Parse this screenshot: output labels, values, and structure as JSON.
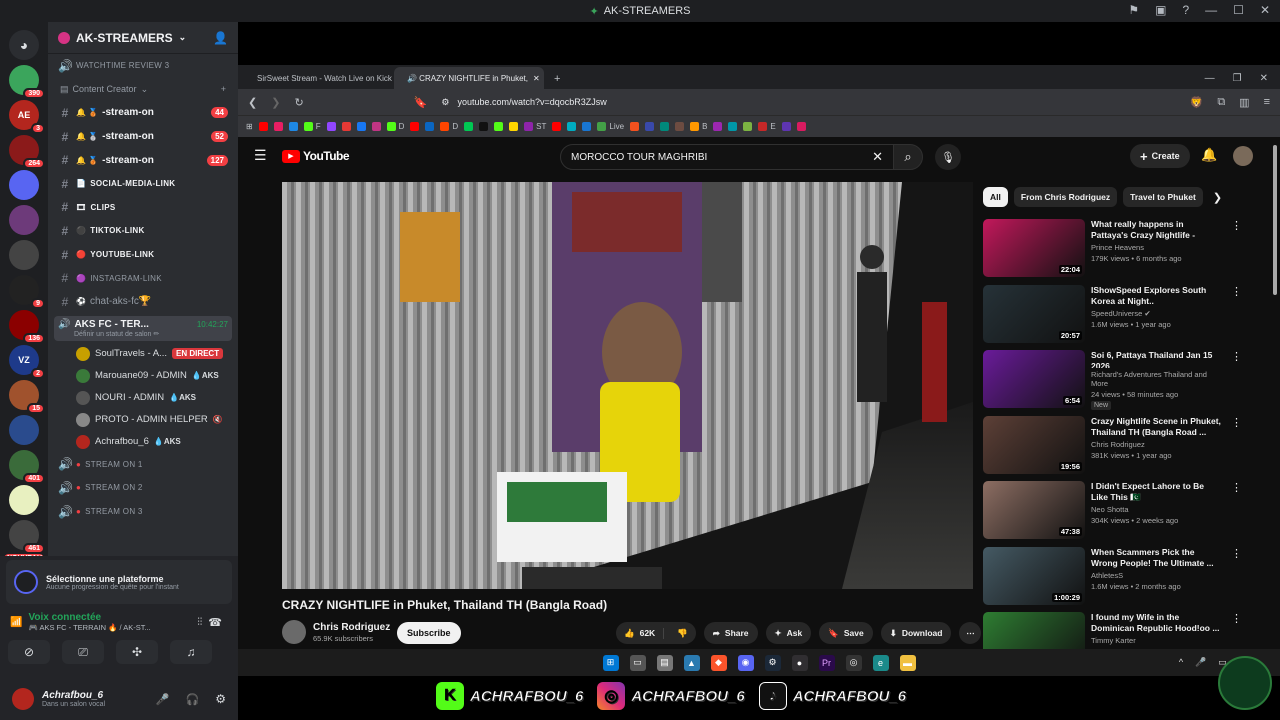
{
  "app": {
    "title": "AK-STREAMERS"
  },
  "rail": {
    "servers": [
      {
        "color": "#2b2d31",
        "label": "",
        "badge": ""
      },
      {
        "color": "#3ba55c",
        "label": "",
        "badge": "390"
      },
      {
        "color": "#b3261e",
        "label": "AE",
        "badge": "3"
      },
      {
        "color": "#8b1a1a",
        "label": "",
        "badge": "264"
      },
      {
        "color": "#5865f2",
        "label": "",
        "badge": ""
      },
      {
        "color": "#6d3a7a",
        "label": "",
        "badge": ""
      },
      {
        "color": "#444",
        "label": "",
        "badge": ""
      },
      {
        "color": "#222",
        "label": "",
        "badge": "9"
      },
      {
        "color": "#8b0000",
        "label": "",
        "badge": "136"
      },
      {
        "color": "#1e3a8a",
        "label": "VZ",
        "badge": "2"
      },
      {
        "color": "#a0522d",
        "label": "",
        "badge": "15"
      },
      {
        "color": "#2a4b8d",
        "label": "",
        "badge": ""
      },
      {
        "color": "#3a6b3a",
        "label": "",
        "badge": "401"
      },
      {
        "color": "#e8f0c0",
        "label": "",
        "badge": ""
      },
      {
        "color": "#444",
        "label": "",
        "badge": "461"
      }
    ],
    "nouveau": "NOUVEAU"
  },
  "sidebar": {
    "server_name": "AK-STREAMERS",
    "channels": [
      {
        "icon": "🔊",
        "prefix": "",
        "label": "WATCHTIME REVIEW 3",
        "count": "",
        "style": "small"
      },
      {
        "icon": "",
        "prefix": "",
        "label": "Content Creator",
        "count": "",
        "style": "category"
      },
      {
        "icon": "#",
        "prefix": "🔔 🥉",
        "label": "-stream-on",
        "count": "44",
        "style": "strong"
      },
      {
        "icon": "#",
        "prefix": "🔔 🥈",
        "label": "-stream-on",
        "count": "52",
        "style": "strong"
      },
      {
        "icon": "#",
        "prefix": "🔔 🥉",
        "label": "-stream-on",
        "count": "127",
        "style": "strong"
      },
      {
        "icon": "#",
        "prefix": "📄",
        "label": "SOCIAL-MEDIA-LINK",
        "count": "",
        "style": "strong small"
      },
      {
        "icon": "#",
        "prefix": "🎞",
        "label": "CLIPS",
        "count": "",
        "style": "strong small"
      },
      {
        "icon": "#",
        "prefix": "⚫",
        "label": "TIKTOK-LINK",
        "count": "",
        "style": "strong small"
      },
      {
        "icon": "#",
        "prefix": "🔴",
        "label": "YOUTUBE-LINK",
        "count": "",
        "style": "strong small"
      },
      {
        "icon": "#",
        "prefix": "🟣",
        "label": "INSTAGRAM-LINK",
        "count": "",
        "style": "small"
      },
      {
        "icon": "#",
        "prefix": "⚽",
        "label": "chat-aks-fc🏆",
        "count": "",
        "style": ""
      }
    ],
    "active_voice": {
      "label": "AKS FC - TER...",
      "time": "10:42:27",
      "status": "Définir un statut de salon ✏"
    },
    "voice_users": [
      {
        "name": "SoulTravels - A...",
        "tag": "EN DIRECT",
        "color": "#c7a000"
      },
      {
        "name": "Marouane09 - ADMIN",
        "tag": "💧AKS",
        "color": "#3a7a3a"
      },
      {
        "name": "NOURI - ADMIN",
        "tag": "💧AKS",
        "color": "#555"
      },
      {
        "name": "PROTO - ADMIN HELPER",
        "tag": "🔇",
        "color": "#888"
      },
      {
        "name": "Achrafbou_6",
        "tag": "💧AKS",
        "color": "#b3261e"
      }
    ],
    "streams": [
      "STREAM ON 1",
      "STREAM ON 2",
      "STREAM ON 3"
    ]
  },
  "panel": {
    "platform_title": "Sélectionne une plateforme",
    "platform_sub": "Aucune progression de quête pour l'instant",
    "voice_title": "Voix connectée",
    "voice_sub": "🎮 AKS FC - TERRAIN 🔥 / AK-ST...",
    "username": "Achrafbou_6",
    "user_status": "Dans un salon vocal"
  },
  "browser": {
    "tabs": [
      {
        "label": "SirSweet Stream - Watch Live on Kick",
        "active": false
      },
      {
        "label": "🔊 CRAZY NIGHTLIFE in Phuket,",
        "active": true
      }
    ],
    "url": "youtube.com/watch?v=dqocbR3ZJsw",
    "bookmarks": [
      "F",
      "D",
      "D",
      "ST",
      "Live",
      "B",
      "E"
    ]
  },
  "youtube": {
    "logo": "YouTube",
    "search_query": "MOROCCO TOUR MAGHRIBI",
    "create_label": "Create",
    "video_title": "CRAZY NIGHTLIFE in Phuket, Thailand TH (Bangla Road)",
    "channel": "Chris Rodriguez",
    "subscribers": "65.9K subscribers",
    "subscribe_label": "Subscribe",
    "likes": "62K",
    "share_label": "Share",
    "ask_label": "Ask",
    "save_label": "Save",
    "download_label": "Download",
    "chips": [
      "All",
      "From Chris Rodriguez",
      "Travel to Phuket"
    ],
    "recommendations": [
      {
        "title": "What really happens in Pattaya's Crazy Nightlife  - Walking stre...",
        "channel": "Prince Heavens",
        "meta": "179K views • 6 months ago",
        "duration": "22:04",
        "color": "#c2185b",
        "extra": ""
      },
      {
        "title": "IShowSpeed Explores South Korea at Night..",
        "channel": "SpeedUniverse ✔",
        "meta": "1.6M views • 1 year ago",
        "duration": "20:57",
        "color": "#263238",
        "extra": ""
      },
      {
        "title": "Soi 6, Pattaya Thailand Jan 15 2026",
        "channel": "Richard's Adventures Thailand and More",
        "meta": "24 views • 58 minutes ago",
        "duration": "6:54",
        "color": "#6a1b9a",
        "extra": "New"
      },
      {
        "title": "Crazy Nightlife Scene in Phuket, Thailand TH (Bangla Road ...",
        "channel": "Chris Rodriguez",
        "meta": "381K views • 1 year ago",
        "duration": "19:56",
        "color": "#5d4037",
        "extra": ""
      },
      {
        "title": "I Didn't Expect Lahore to Be Like This 🇵🇰",
        "channel": "Neo Shotta",
        "meta": "304K views • 2 weeks ago",
        "duration": "47:38",
        "color": "#8d6e63",
        "extra": ""
      },
      {
        "title": "When Scammers Pick the Wrong People! The Ultimate ...",
        "channel": "AthletesS",
        "meta": "1.6M views • 2 months ago",
        "duration": "1:00:29",
        "color": "#455a64",
        "extra": ""
      },
      {
        "title": "I found my Wife in the Dominican Republic Hood!oo ...",
        "channel": "Timmy Karter",
        "meta": "",
        "duration": "",
        "color": "#2e7d32",
        "extra": ""
      }
    ]
  },
  "social": {
    "handles": [
      "ACHRAFBOU_6",
      "ACHRAFBOU_6",
      "ACHRAFBOU_6"
    ]
  }
}
